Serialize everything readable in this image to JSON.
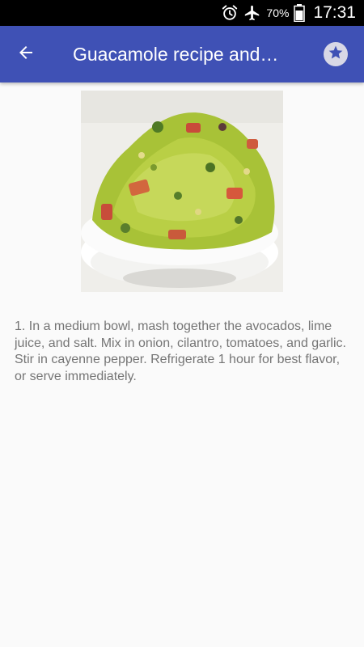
{
  "status_bar": {
    "battery_percent": "70%",
    "time": "17:31",
    "icons": [
      "alarm-icon",
      "airplane-mode-icon",
      "battery-icon"
    ]
  },
  "app_bar": {
    "title": "Guacamole recipe and…",
    "background_color": "#3f51b5",
    "back_icon": "arrow-left-icon",
    "favorite_icon": "star-icon"
  },
  "recipe": {
    "image": "guacamole-photo",
    "instructions": "1. In a medium bowl, mash together the avocados, lime juice, and salt. Mix in onion, cilantro, tomatoes, and garlic. Stir in cayenne pepper. Refrigerate 1 hour for best flavor, or serve immediately."
  }
}
